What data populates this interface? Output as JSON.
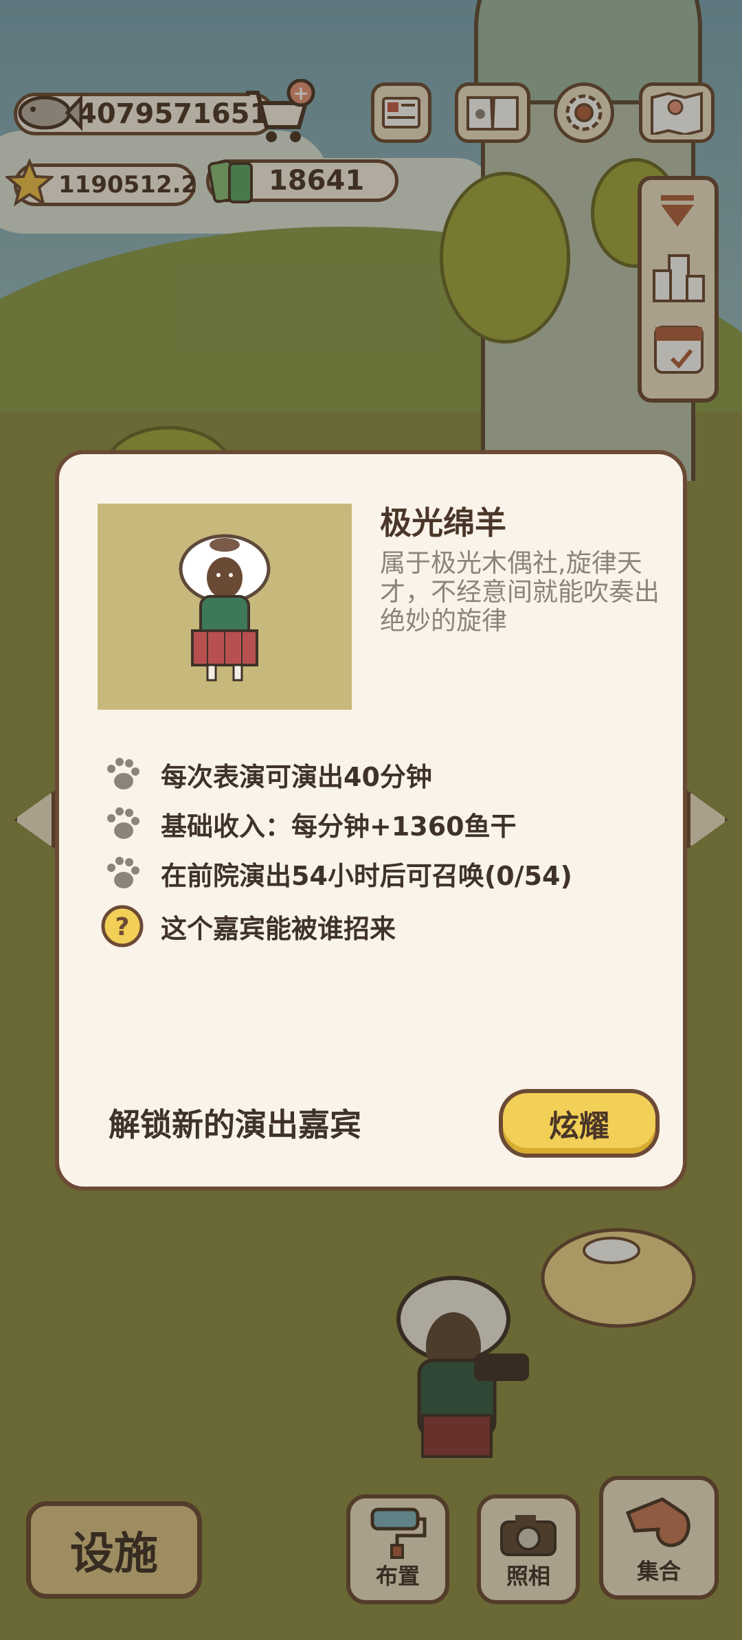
{
  "hud": {
    "fish_count": "4079571651",
    "star_count": "1190512.2",
    "ticket_count": "18641"
  },
  "guest_modal": {
    "name": "极光绵羊",
    "description": "属于极光木偶社,旋律天才，不经意间就能吹奏出绝妙的旋律",
    "stats": [
      {
        "icon": "paw-icon",
        "text": "每次表演可演出40分钟"
      },
      {
        "icon": "paw-icon",
        "text": "基础收入：每分钟+1360鱼干"
      },
      {
        "icon": "paw-icon",
        "text": "在前院演出54小时后可召唤(0/54)"
      },
      {
        "icon": "question-icon",
        "text": "这个嘉宾能被谁招来"
      }
    ],
    "unlock_text": "解锁新的演出嘉宾",
    "show_button": "炫耀"
  },
  "bottom_bar": {
    "facility": "设施",
    "layout": "布置",
    "photo": "照相",
    "gather": "集合"
  },
  "colors": {
    "panel_bg": "#faf3ea",
    "border": "#6b4a35",
    "button_yellow": "#f2cf56",
    "portrait_bg": "#c7b87c"
  }
}
